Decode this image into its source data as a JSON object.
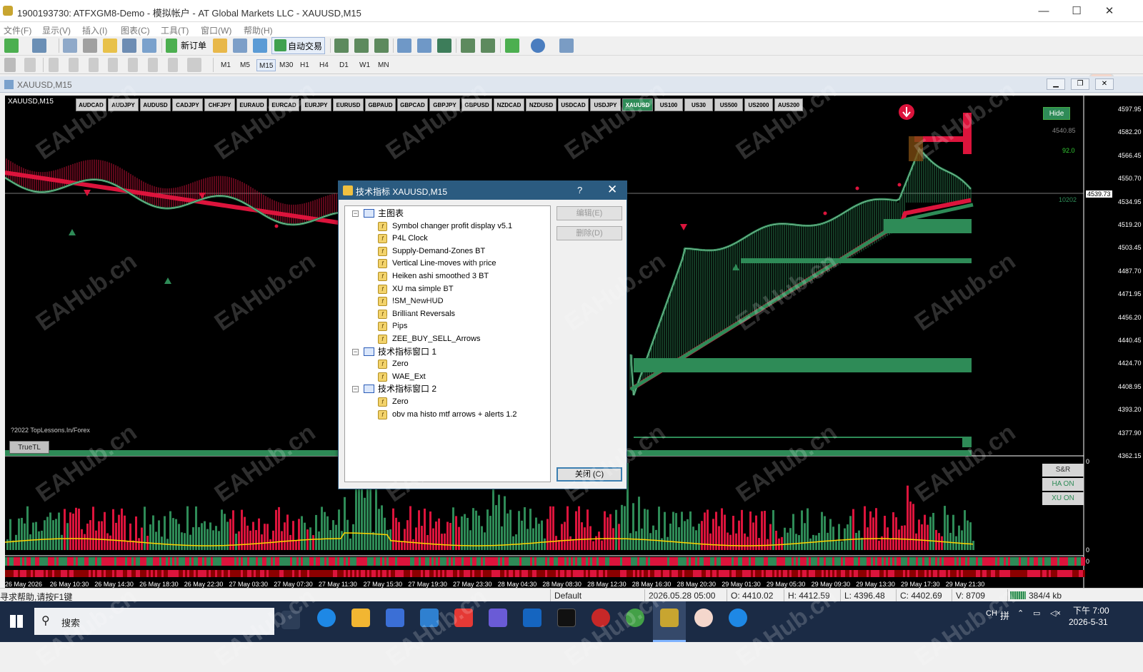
{
  "window": {
    "title": "1900193730: ATFXGM8-Demo - 模拟帐户 - AT Global Markets LLC - XAUUSD,M15",
    "minimize": "—",
    "maximize": "☐",
    "close": "✕"
  },
  "menu": [
    "文件(F)",
    "显示(V)",
    "插入(I)",
    "图表(C)",
    "工具(T)",
    "窗口(W)",
    "帮助(H)"
  ],
  "toolbar": {
    "new_order": "新订单",
    "auto_trade": "自动交易",
    "timeframes": [
      "M1",
      "M5",
      "M15",
      "M30",
      "H1",
      "H4",
      "D1",
      "W1",
      "MN"
    ],
    "active_timeframe": "M15"
  },
  "chart_window": {
    "title": "XAUUSD,M15",
    "symbol_label": "XAUUSD,M15"
  },
  "symbols": [
    "AUDCAD",
    "AUDJPY",
    "AUDUSD",
    "CADJPY",
    "CHFJPY",
    "EURAUD",
    "EURCAD",
    "EURJPY",
    "EURUSD",
    "GBPAUD",
    "GBPCAD",
    "GBPJPY",
    "GBPUSD",
    "NZDCAD",
    "NZDUSD",
    "USDCAD",
    "USDJPY",
    "XAUUSD",
    "US100",
    "US30",
    "US500",
    "US2000",
    "AUS200"
  ],
  "active_symbol": "XAUUSD",
  "price_axis": [
    "4597.95",
    "4582.20",
    "4566.45",
    "4550.70",
    "4534.95",
    "4519.20",
    "4503.45",
    "4487.70",
    "4471.95",
    "4456.20",
    "4440.45",
    "4424.70",
    "4408.95",
    "4393.20",
    "4377.90",
    "4362.15"
  ],
  "current_price": "4539.73",
  "extra_labels": {
    "high_tag": "4540.85",
    "pips": "92.0",
    "small": "10202"
  },
  "time_axis": [
    "26 May 2026",
    "26 May 10:30",
    "26 May 14:30",
    "26 May 18:30",
    "26 May 22:30",
    "27 May 03:30",
    "27 May 07:30",
    "27 May 11:30",
    "27 May 15:30",
    "27 May 19:30",
    "27 May 23:30",
    "28 May 04:30",
    "28 May 08:30",
    "28 May 12:30",
    "28 May 16:30",
    "28 May 20:30",
    "29 May 01:30",
    "29 May 05:30",
    "29 May 09:30",
    "29 May 13:30",
    "29 May 17:30",
    "29 May 21:30"
  ],
  "sub_axis": {
    "top": "0",
    "bottom": "0",
    "tiny": "0"
  },
  "buttons": {
    "hide": "Hide",
    "truetl": "TrueTL",
    "sr": "S&R",
    "ha_on": "HA ON",
    "xu_on": "XU ON"
  },
  "copyright": "?2022 TopLessons.In/Forex",
  "dialog": {
    "title": "技术指标 XAUUSD,M15",
    "help": "?",
    "close_x": "✕",
    "edit": "编辑(E)",
    "delete": "删除(D)",
    "close": "关闭 (C)",
    "groups": [
      {
        "name": "主图表",
        "items": [
          "Symbol changer profit display v5.1",
          "P4L Clock",
          "Supply-Demand-Zones BT",
          "Vertical Line-moves with price",
          "Heiken ashi smoothed 3 BT",
          "XU ma simple BT",
          "!SM_NewHUD",
          "Brilliant Reversals",
          "Pips",
          "ZEE_BUY_SELL_Arrows"
        ]
      },
      {
        "name": "技术指标窗口 1",
        "items": [
          "Zero",
          "WAE_Ext"
        ]
      },
      {
        "name": "技术指标窗口 2",
        "items": [
          "Zero",
          "obv ma histo mtf arrows + alerts 1.2"
        ]
      }
    ]
  },
  "status": {
    "help": "寻求帮助,请按F1键",
    "profile": "Default",
    "datetime": "2026.05.28 05:00",
    "open": "O: 4410.02",
    "high": "H: 4412.59",
    "low": "L: 4396.48",
    "close": "C: 4402.69",
    "volume": "V: 8709",
    "traffic": "384/4 kb"
  },
  "taskbar": {
    "search": "搜索",
    "lang": "CH",
    "ime": "拼",
    "time": "下午 7:00",
    "date": "2026-5-31"
  },
  "watermark": "EAHub.cn",
  "colors": {
    "bull": "#2e8b57",
    "bear": "#dc143c",
    "dialog_bar": "#2b5b80",
    "taskbar": "#1b2b45"
  }
}
